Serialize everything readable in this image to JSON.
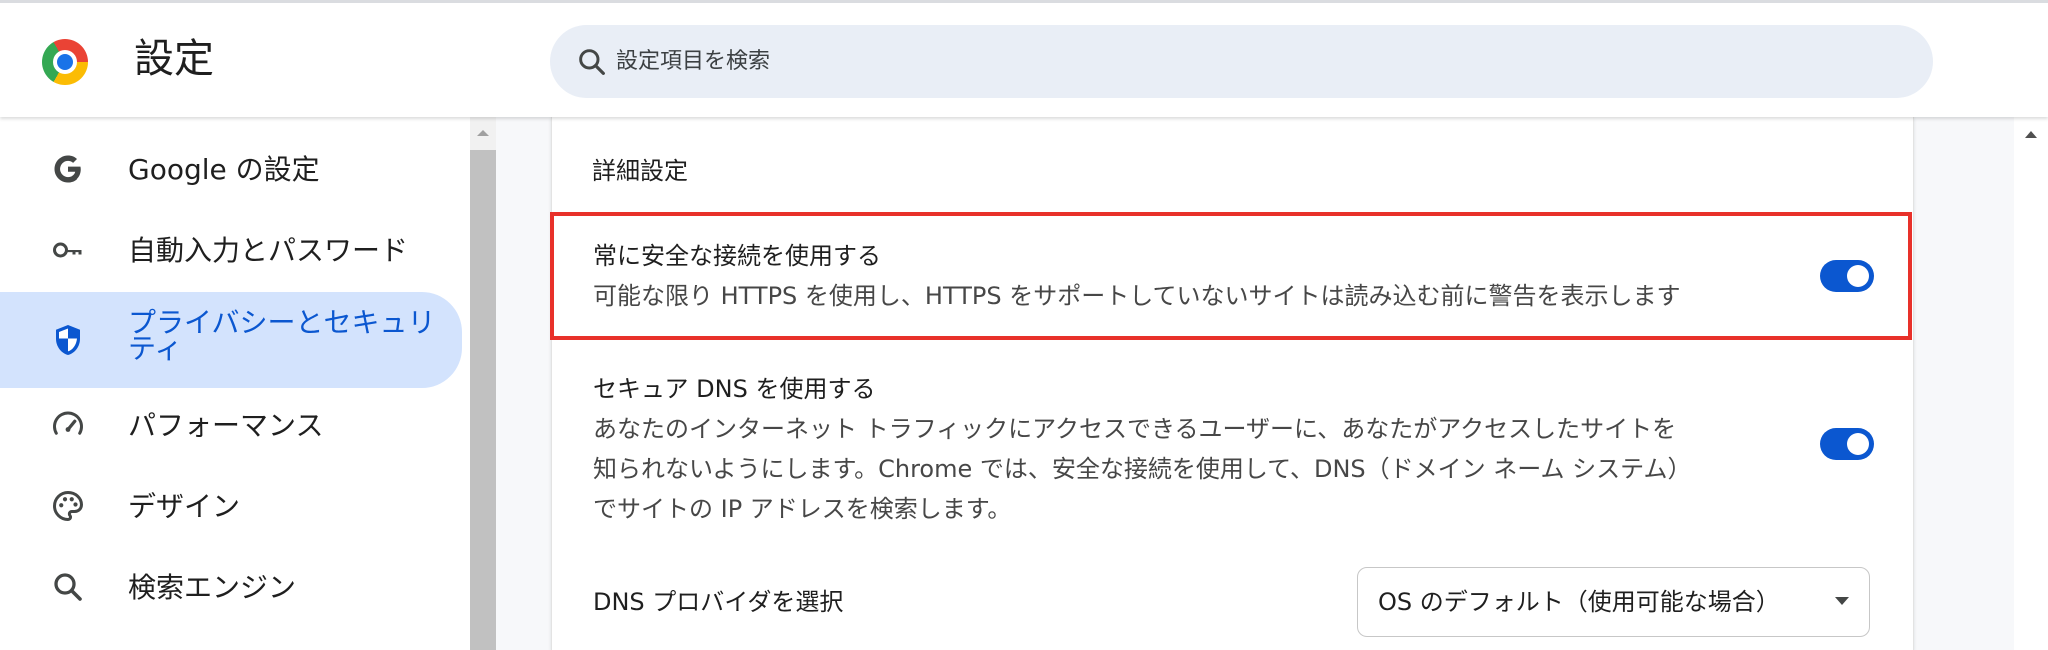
{
  "header": {
    "title": "設定",
    "search_placeholder": "設定項目を検索"
  },
  "sidebar": {
    "items": [
      {
        "label": "Google の設定",
        "icon": "google-g-icon"
      },
      {
        "label": "自動入力とパスワード",
        "icon": "key-icon"
      },
      {
        "label": "プライバシーとセキュリティ",
        "icon": "shield-icon",
        "active": true
      },
      {
        "label": "パフォーマンス",
        "icon": "speedometer-icon"
      },
      {
        "label": "デザイン",
        "icon": "palette-icon"
      },
      {
        "label": "検索エンジン",
        "icon": "search-icon"
      }
    ]
  },
  "main": {
    "section_title": "詳細設定",
    "settings": [
      {
        "title": "常に安全な接続を使用する",
        "description": "可能な限り HTTPS を使用し、HTTPS をサポートしていないサイトは読み込む前に警告を表示します",
        "enabled": true,
        "highlighted": true
      },
      {
        "title": "セキュア DNS を使用する",
        "description_lines": [
          "あなたのインターネット トラフィックにアクセスできるユーザーに、あなたがアクセスしたサイトを",
          "知られないようにします。Chrome では、安全な接続を使用して、DNS（ドメイン ネーム システム）",
          "でサイトの IP アドレスを検索します。"
        ],
        "enabled": true
      }
    ],
    "dns_provider": {
      "label": "DNS プロバイダを選択",
      "selected": "OS のデフォルト（使用可能な場合）"
    }
  },
  "colors": {
    "accent": "#0b57d0",
    "active_nav_bg": "#d3e3fd",
    "highlight_border": "#e8312a",
    "search_bg": "#e9eef6"
  }
}
